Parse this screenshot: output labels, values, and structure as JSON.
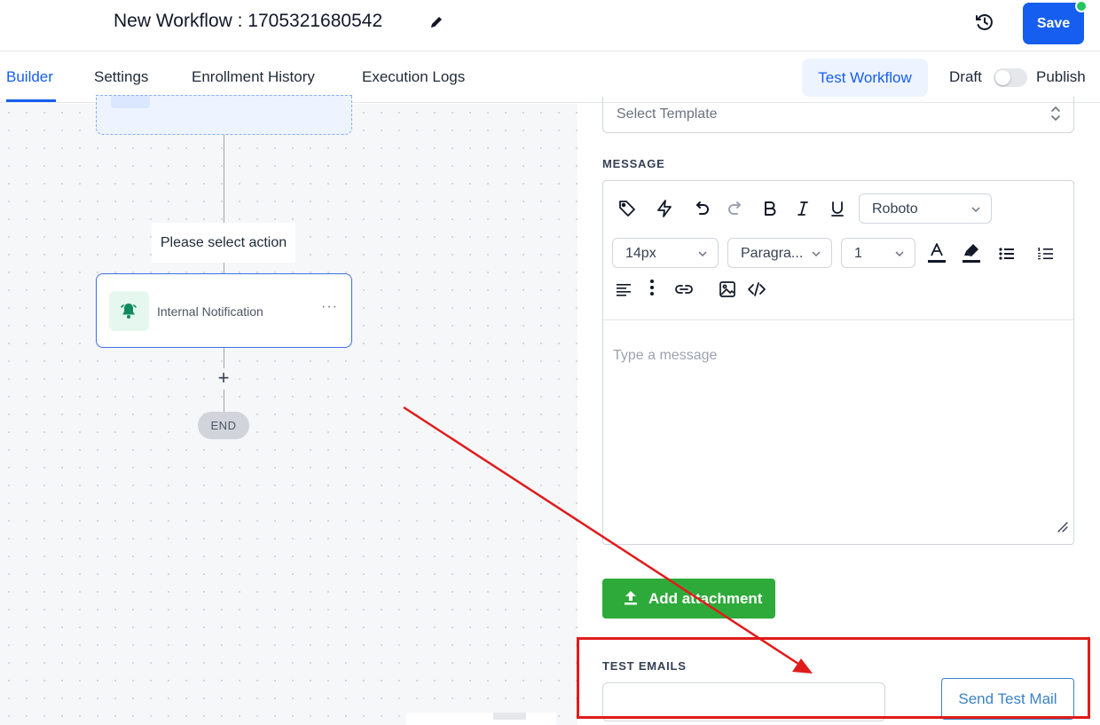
{
  "header": {
    "title": "New Workflow : 1705321680542",
    "save_label": "Save",
    "edit_icon": "pencil-icon",
    "history_icon": "history-icon",
    "status_dot_color": "#22c55e",
    "accent_color": "#155eef"
  },
  "tabs": [
    {
      "label": "Builder",
      "active": true
    },
    {
      "label": "Settings",
      "active": false
    },
    {
      "label": "Enrollment History",
      "active": false
    },
    {
      "label": "Execution Logs",
      "active": false
    }
  ],
  "toolbar_right": {
    "test_workflow_label": "Test Workflow",
    "draft_label": "Draft",
    "publish_label": "Publish",
    "published": false
  },
  "canvas": {
    "select_action_label": "Please select action",
    "action_card": {
      "label": "Internal Notification",
      "icon": "bell-icon",
      "more_icon": "more-horizontal-icon",
      "more_text": "···"
    },
    "add_step_text": "+",
    "end_label": "END"
  },
  "panel": {
    "template_placeholder": "Select Template",
    "message_label": "MESSAGE",
    "editor": {
      "icons_row1": [
        "tag-icon",
        "lightning-icon",
        "undo-icon",
        "redo-icon",
        "bold-icon",
        "italic-icon",
        "underline-icon"
      ],
      "font_family": "Roboto",
      "font_size": "14px",
      "block_format": "Paragra...",
      "line_height": "1",
      "icons_row2": [
        "text-color-icon",
        "highlight-icon",
        "bullet-list-icon",
        "numbered-list-icon"
      ],
      "icons_row3": [
        "align-left-icon",
        "more-vertical-icon",
        "link-icon",
        "image-icon",
        "code-icon"
      ],
      "placeholder": "Type a message"
    },
    "attach_label": "Add attachment",
    "attach_color": "#2eaa3a",
    "test_emails_label": "TEST EMAILS",
    "test_email_value": "",
    "send_test_label": "Send Test Mail"
  },
  "annotation": {
    "color": "#e01b1b"
  }
}
